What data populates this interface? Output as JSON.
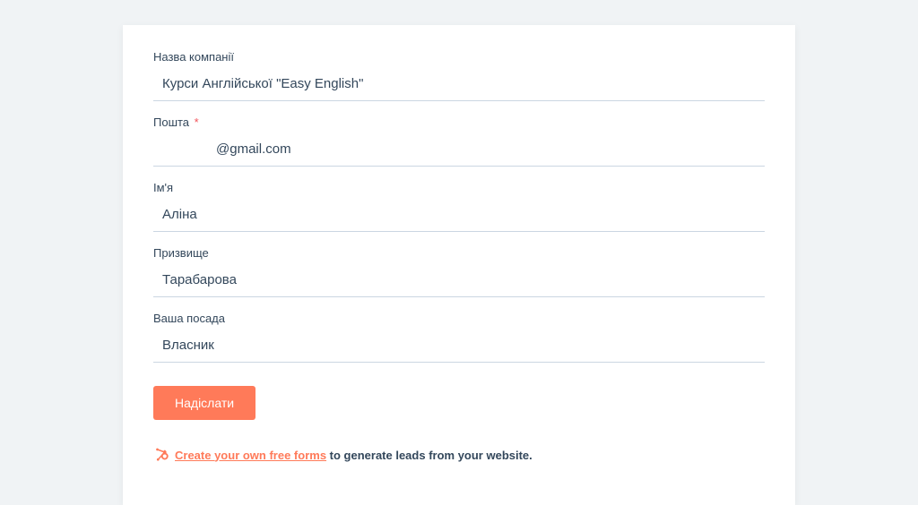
{
  "fields": {
    "company": {
      "label": "Назва компанії",
      "value": "Курси Англійської \"Easy English\""
    },
    "email": {
      "label": "Пошта",
      "required": "*",
      "value": "@gmail.com"
    },
    "firstname": {
      "label": "Ім'я",
      "value": "Аліна"
    },
    "lastname": {
      "label": "Призвище",
      "value": "Тарабарова"
    },
    "position": {
      "label": "Ваша посада",
      "value": "Власник"
    }
  },
  "submit": {
    "label": "Надіслати"
  },
  "footer": {
    "link_text": "Create your own free forms",
    "rest_text": " to generate leads from your website."
  }
}
